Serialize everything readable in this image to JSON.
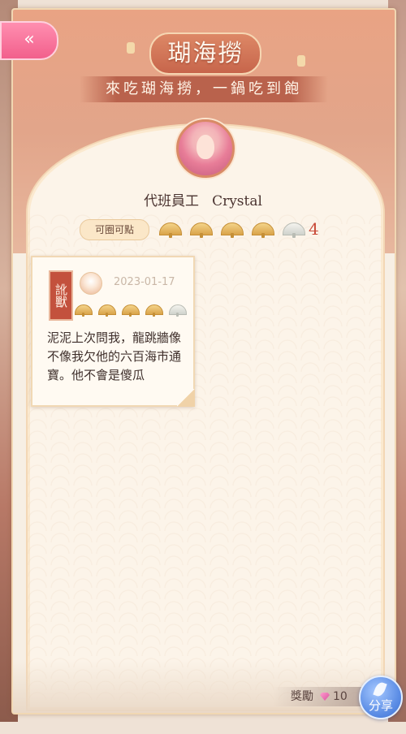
{
  "header": {
    "title": "瑚海撈",
    "subtitle": "來吃瑚海撈，一鍋吃到飽",
    "back_icon": "double-chevron-left-icon"
  },
  "profile": {
    "role": "代班員工",
    "name": "Crystal",
    "likes_label": "可圈可點",
    "rating": {
      "filled": 4,
      "total": 5,
      "count": "4"
    }
  },
  "note": {
    "stamp": "訛獸",
    "date": "2023-01-17",
    "rating": {
      "filled": 4,
      "total": 5
    },
    "text": "泥泥上次問我，龍跳牆像不像我欠他的六百海市通寶。他不會是傻瓜"
  },
  "footer": {
    "reward_label": "獎勵",
    "reward_value": "10",
    "share_label": "分享"
  },
  "colors": {
    "accent": "#c94b39",
    "header": "#e2a58a",
    "back_button": "#f25f8c",
    "share_button": "#5e8fe6"
  }
}
